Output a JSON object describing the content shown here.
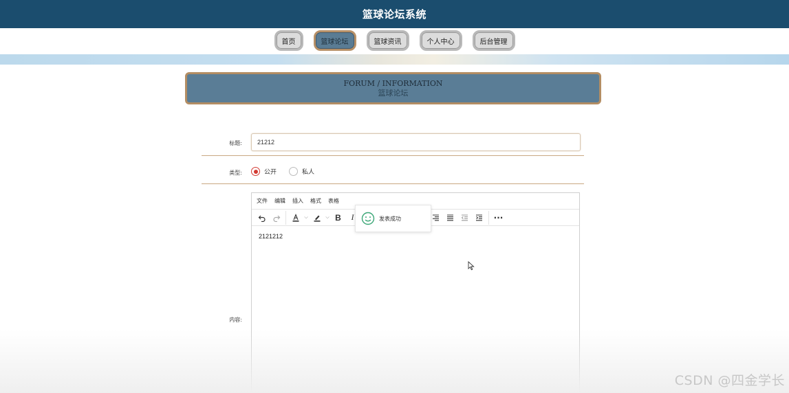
{
  "header": {
    "title": "篮球论坛系统"
  },
  "nav": {
    "items": [
      {
        "label": "首页"
      },
      {
        "label": "篮球论坛"
      },
      {
        "label": "篮球资讯"
      },
      {
        "label": "个人中心"
      },
      {
        "label": "后台管理"
      }
    ],
    "active_index": 1
  },
  "section": {
    "title_en": "FORUM / INFORMATION",
    "title_cn": "篮球论坛"
  },
  "form": {
    "title_label": "标题:",
    "title_value": "21212",
    "type_label": "类型:",
    "type_options": [
      "公开",
      "私人"
    ],
    "type_selected": "公开",
    "content_label": "内容:"
  },
  "editor": {
    "menu": [
      "文件",
      "编辑",
      "插入",
      "格式",
      "表格"
    ],
    "content": "2121212"
  },
  "toast": {
    "message": "发表成功"
  },
  "watermark": "CSDN @四金学长",
  "colors": {
    "header_bg": "#1b4d6e",
    "active_tab": "#5a7c94",
    "accent_border": "#b38d63",
    "radio": "#d33a32"
  }
}
